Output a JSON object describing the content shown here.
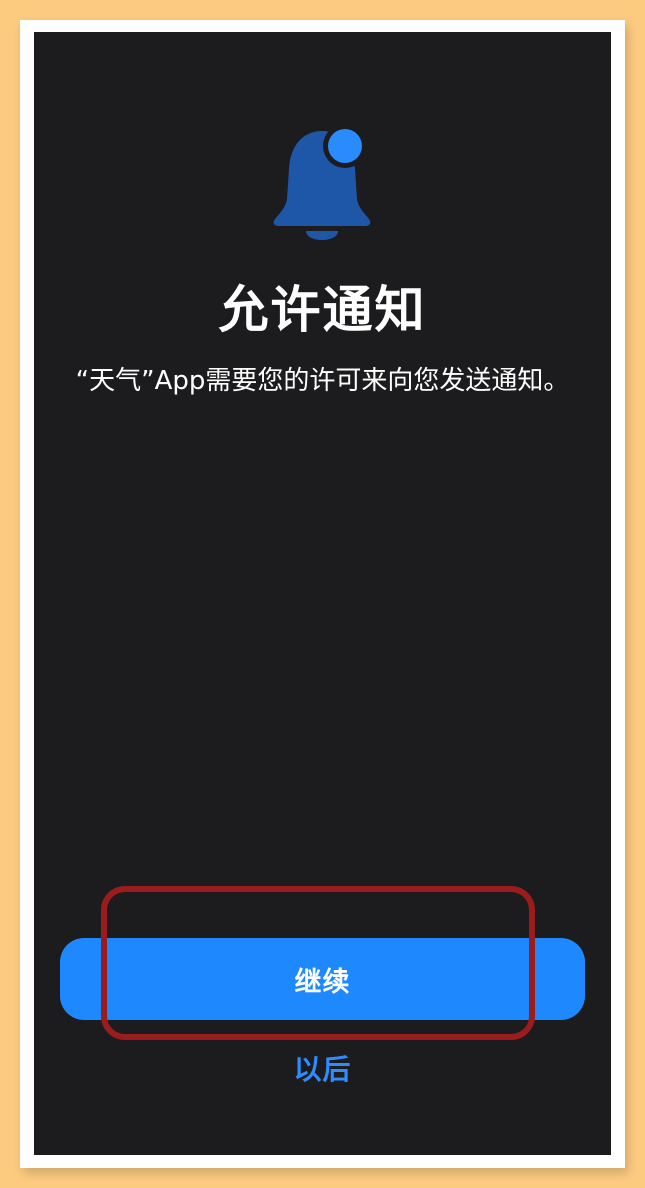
{
  "permission": {
    "title": "允许通知",
    "message": "“天气”App需要您的许可来向您发送通知。",
    "continue_label": "继续",
    "later_label": "以后"
  },
  "icons": {
    "notification": "bell-badge-icon"
  },
  "colors": {
    "background": "#1C1C1E",
    "accent": "#1E88FF",
    "bell": "#1F57A8",
    "badge": "#2A8BFF",
    "annotation": "#9B1C1C",
    "outer_backdrop": "#FDCB80"
  }
}
